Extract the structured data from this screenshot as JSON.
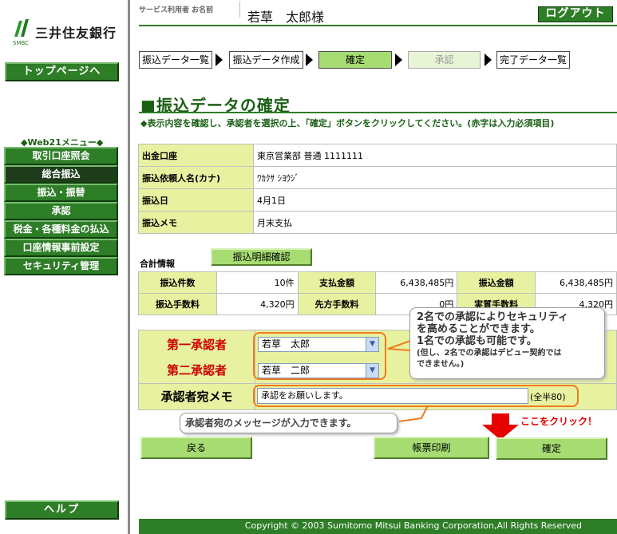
{
  "sidebar": {
    "logo_text": "三井住友銀行",
    "logo_sub": "SMBC",
    "top_page_label": "トップページへ",
    "menu_title": "◆Web21メニュー◆",
    "menu_items": [
      {
        "label": "取引口座照会"
      },
      {
        "label": "総合振込"
      },
      {
        "label": "振込・振替"
      },
      {
        "label": "承認"
      },
      {
        "label": "税金・各種料金の払込"
      },
      {
        "label": "口座情報事前設定"
      },
      {
        "label": "セキュリティ管理"
      }
    ],
    "help_label": "ヘルプ"
  },
  "header": {
    "user_label": "サービス利用者 お名前",
    "user_name": "若草　太郎様",
    "logout_label": "ログアウト"
  },
  "steps": [
    {
      "label": "振込データ一覧"
    },
    {
      "label": "振込データ作成"
    },
    {
      "label": "確定"
    },
    {
      "label": "承認"
    },
    {
      "label": "完了データ一覧"
    }
  ],
  "page": {
    "title": "■振込データの確定",
    "instructions": "◆表示内容を確認し、承認者を選択の上、「確定」ボタンをクリックしてください。(赤字は入力必須項目)"
  },
  "details": [
    {
      "label": "出金口座",
      "value": "東京営業部 普通 1111111"
    },
    {
      "label": "振込依頼人名(カナ)",
      "value": "ﾜｶｸｻ ｼﾖｳｼﾞ"
    },
    {
      "label": "振込日",
      "value": "4月1日"
    },
    {
      "label": "振込メモ",
      "value": "月末支払"
    }
  ],
  "totals": {
    "section_label": "合計情報",
    "detail_check_label": "振込明細確認",
    "rows": [
      [
        {
          "label": "振込件数",
          "value": "10件"
        },
        {
          "label": "支払金額",
          "value": "6,438,485円"
        },
        {
          "label": "振込金額",
          "value": "6,438,485円"
        }
      ],
      [
        {
          "label": "振込手数料",
          "value": "4,320円"
        },
        {
          "label": "先方手数料",
          "value": "0円"
        },
        {
          "label": "実質手数料",
          "value": "4,320円"
        }
      ]
    ]
  },
  "approvers": {
    "first_label": "第一承認者",
    "first_value": "若草　太郎",
    "second_label": "第二承認者",
    "second_value": "若草　二郎",
    "memo_label": "承認者宛メモ",
    "memo_value": "承認をお願いします。",
    "memo_note": "(全半80)"
  },
  "callouts": {
    "security_line1": "2名での承認によりセキュリティ",
    "security_line2": "を高めることができます。",
    "security_line3": "1名での承認も可能です。",
    "security_line4": "(但し、2名での承認はデビュー契約では",
    "security_line5": "できません。)",
    "memo_hint": "承認者宛のメッセージが入力できます。",
    "click_here": "ここをクリック！"
  },
  "buttons": {
    "back_label": "戻る",
    "print_label": "帳票印刷",
    "confirm_label": "確定"
  },
  "footer": {
    "copyright": "Copyright © 2003 Sumitomo Mitsui Banking Corporation,All Rights Reserved"
  },
  "colors": {
    "brand_green": "#2e7d27",
    "light_green": "#a6dc72",
    "pale_yellow": "#e8f1a0",
    "required_red": "#cc0000",
    "highlight_orange": "#f07a20"
  }
}
